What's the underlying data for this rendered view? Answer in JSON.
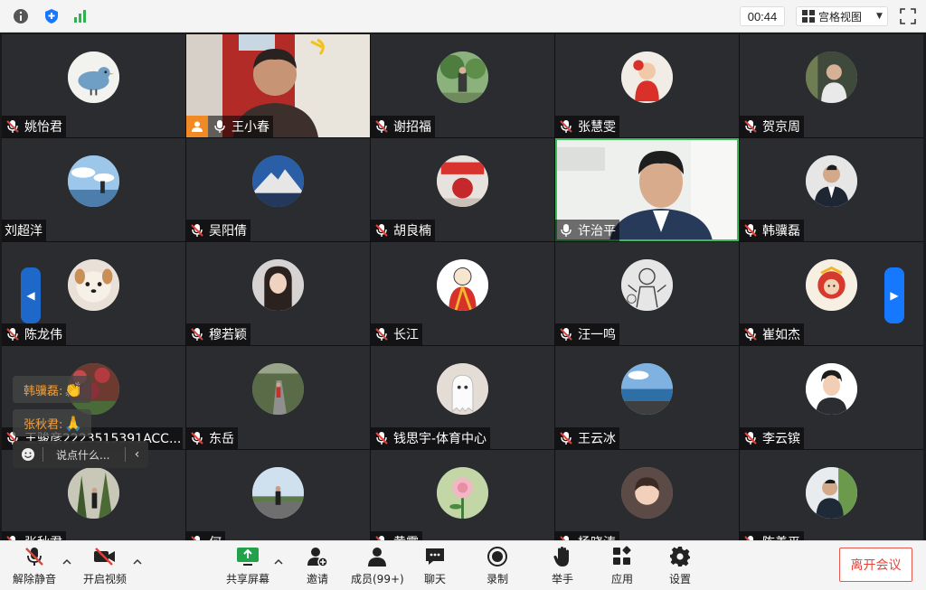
{
  "topbar": {
    "icons": [
      "info-icon",
      "shield-icon",
      "signal-icon"
    ],
    "timer": "00:44",
    "view_label": "宫格视图",
    "fullscreen_icon": "fullscreen-icon"
  },
  "participants": [
    {
      "name": "姚怡君",
      "muted": true,
      "avatar": "bird"
    },
    {
      "name": "王小春",
      "muted": false,
      "avatar": "video",
      "host": true
    },
    {
      "name": "谢招福",
      "muted": true,
      "avatar": "photo-green"
    },
    {
      "name": "张慧雯",
      "muted": true,
      "avatar": "photo-baby"
    },
    {
      "name": "贺京周",
      "muted": true,
      "avatar": "photo-man"
    },
    {
      "name": "刘超洋",
      "muted": false,
      "avatar": "photo-sky",
      "no_icon": true
    },
    {
      "name": "吴阳倩",
      "muted": true,
      "avatar": "photo-mountain"
    },
    {
      "name": "胡良楠",
      "muted": true,
      "avatar": "photo-red"
    },
    {
      "name": "许治平",
      "muted": false,
      "avatar": "video-speaker",
      "active": true
    },
    {
      "name": "韩骥磊",
      "muted": true,
      "avatar": "photo-suit"
    },
    {
      "name": "陈龙伟",
      "muted": true,
      "avatar": "dog"
    },
    {
      "name": "穆若颖",
      "muted": true,
      "avatar": "photo-girl"
    },
    {
      "name": "长江",
      "muted": true,
      "avatar": "cartoon-monk"
    },
    {
      "name": "汪一鸣",
      "muted": true,
      "avatar": "sketch"
    },
    {
      "name": "崔如杰",
      "muted": true,
      "avatar": "cartoon-god"
    },
    {
      "name": "王骏彦2223515391ACC...",
      "muted": true,
      "avatar": "photo-flowers"
    },
    {
      "name": "东岳",
      "muted": true,
      "avatar": "photo-road"
    },
    {
      "name": "钱思宇-体育中心",
      "muted": true,
      "avatar": "ghost"
    },
    {
      "name": "王云冰",
      "muted": true,
      "avatar": "photo-sea"
    },
    {
      "name": "李云镔",
      "muted": true,
      "avatar": "cartoon-man"
    },
    {
      "name": "张秋君",
      "muted": true,
      "avatar": "photo-forest"
    },
    {
      "name": "何",
      "muted": true,
      "avatar": "photo-road2"
    },
    {
      "name": "黄霞",
      "muted": true,
      "avatar": "photo-rose"
    },
    {
      "name": "杨晓涛",
      "muted": true,
      "avatar": "photo-kid"
    },
    {
      "name": "陈善平",
      "muted": true,
      "avatar": "photo-man2"
    }
  ],
  "reactions": [
    {
      "name": "韩骥磊:",
      "emoji": "👏"
    },
    {
      "name": "张秋君:",
      "emoji": "🙏"
    }
  ],
  "chat": {
    "placeholder": "说点什么...",
    "emoji_icon": "smiley-icon",
    "collapse_icon": "chevron-left-icon"
  },
  "toolbar": {
    "unmute": "解除静音",
    "start_video": "开启视频",
    "share_screen": "共享屏幕",
    "invite": "邀请",
    "members": "成员(99+)",
    "chat": "聊天",
    "record": "录制",
    "raise_hand": "举手",
    "apps": "应用",
    "settings": "设置",
    "leave": "离开会议"
  },
  "colors": {
    "accent": "#1677ff",
    "leave": "#e5463c",
    "active_speaker": "#3dbb5b",
    "muted_icon": "#e0433b"
  }
}
